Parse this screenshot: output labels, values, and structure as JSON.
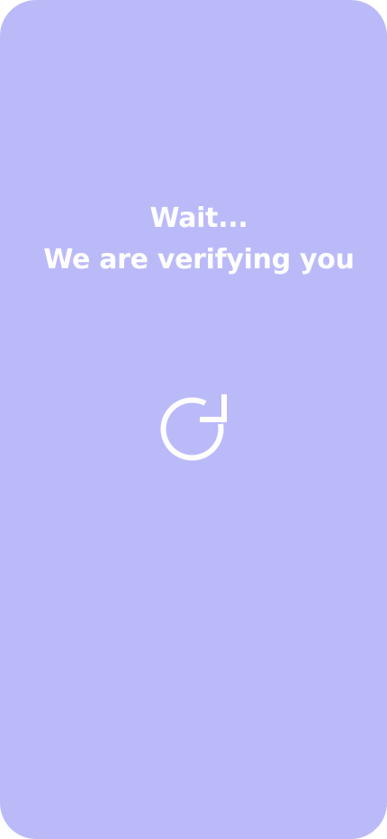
{
  "screen": {
    "background_color": "#bbbaf9",
    "text_color": "#ffffff"
  },
  "status": {
    "title": "Wait...",
    "subtitle": "We are verifying you"
  },
  "loader": {
    "icon": "refresh-icon"
  }
}
